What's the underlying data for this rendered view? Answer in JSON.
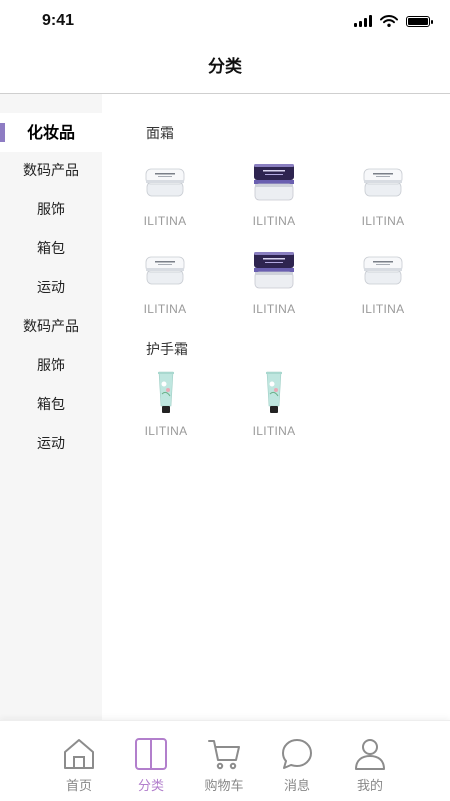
{
  "status": {
    "time": "9:41"
  },
  "header": {
    "title": "分类"
  },
  "sidebar": {
    "items": [
      {
        "label": "化妆品",
        "active": true
      },
      {
        "label": "数码产品"
      },
      {
        "label": "服饰"
      },
      {
        "label": "箱包"
      },
      {
        "label": "运动"
      },
      {
        "label": "数码产品"
      },
      {
        "label": "服饰"
      },
      {
        "label": "箱包"
      },
      {
        "label": "运动"
      }
    ]
  },
  "sections": [
    {
      "title": "面霜",
      "products": [
        {
          "brand": "ILITINA",
          "image": "white-cream-jar"
        },
        {
          "brand": "ILITINA",
          "image": "purple-cream-jar"
        },
        {
          "brand": "ILITINA",
          "image": "white-cream-jar"
        },
        {
          "brand": "ILITINA",
          "image": "white-cream-jar"
        },
        {
          "brand": "ILITINA",
          "image": "purple-cream-jar"
        },
        {
          "brand": "ILITINA",
          "image": "white-cream-jar"
        }
      ]
    },
    {
      "title": "护手霜",
      "products": [
        {
          "brand": "ILITINA",
          "image": "hand-cream-tube"
        },
        {
          "brand": "ILITINA",
          "image": "hand-cream-tube"
        }
      ]
    }
  ],
  "tabbar": {
    "items": [
      {
        "label": "首页",
        "icon": "home-icon"
      },
      {
        "label": "分类",
        "icon": "category-icon",
        "active": true
      },
      {
        "label": "购物车",
        "icon": "cart-icon"
      },
      {
        "label": "消息",
        "icon": "message-icon"
      },
      {
        "label": "我的",
        "icon": "user-icon"
      }
    ]
  },
  "colors": {
    "accent": "#b27fcc",
    "indicator": "#8e7cc3",
    "sidebar_bg": "#f6f6f6",
    "muted_text": "#9a9a9a"
  }
}
